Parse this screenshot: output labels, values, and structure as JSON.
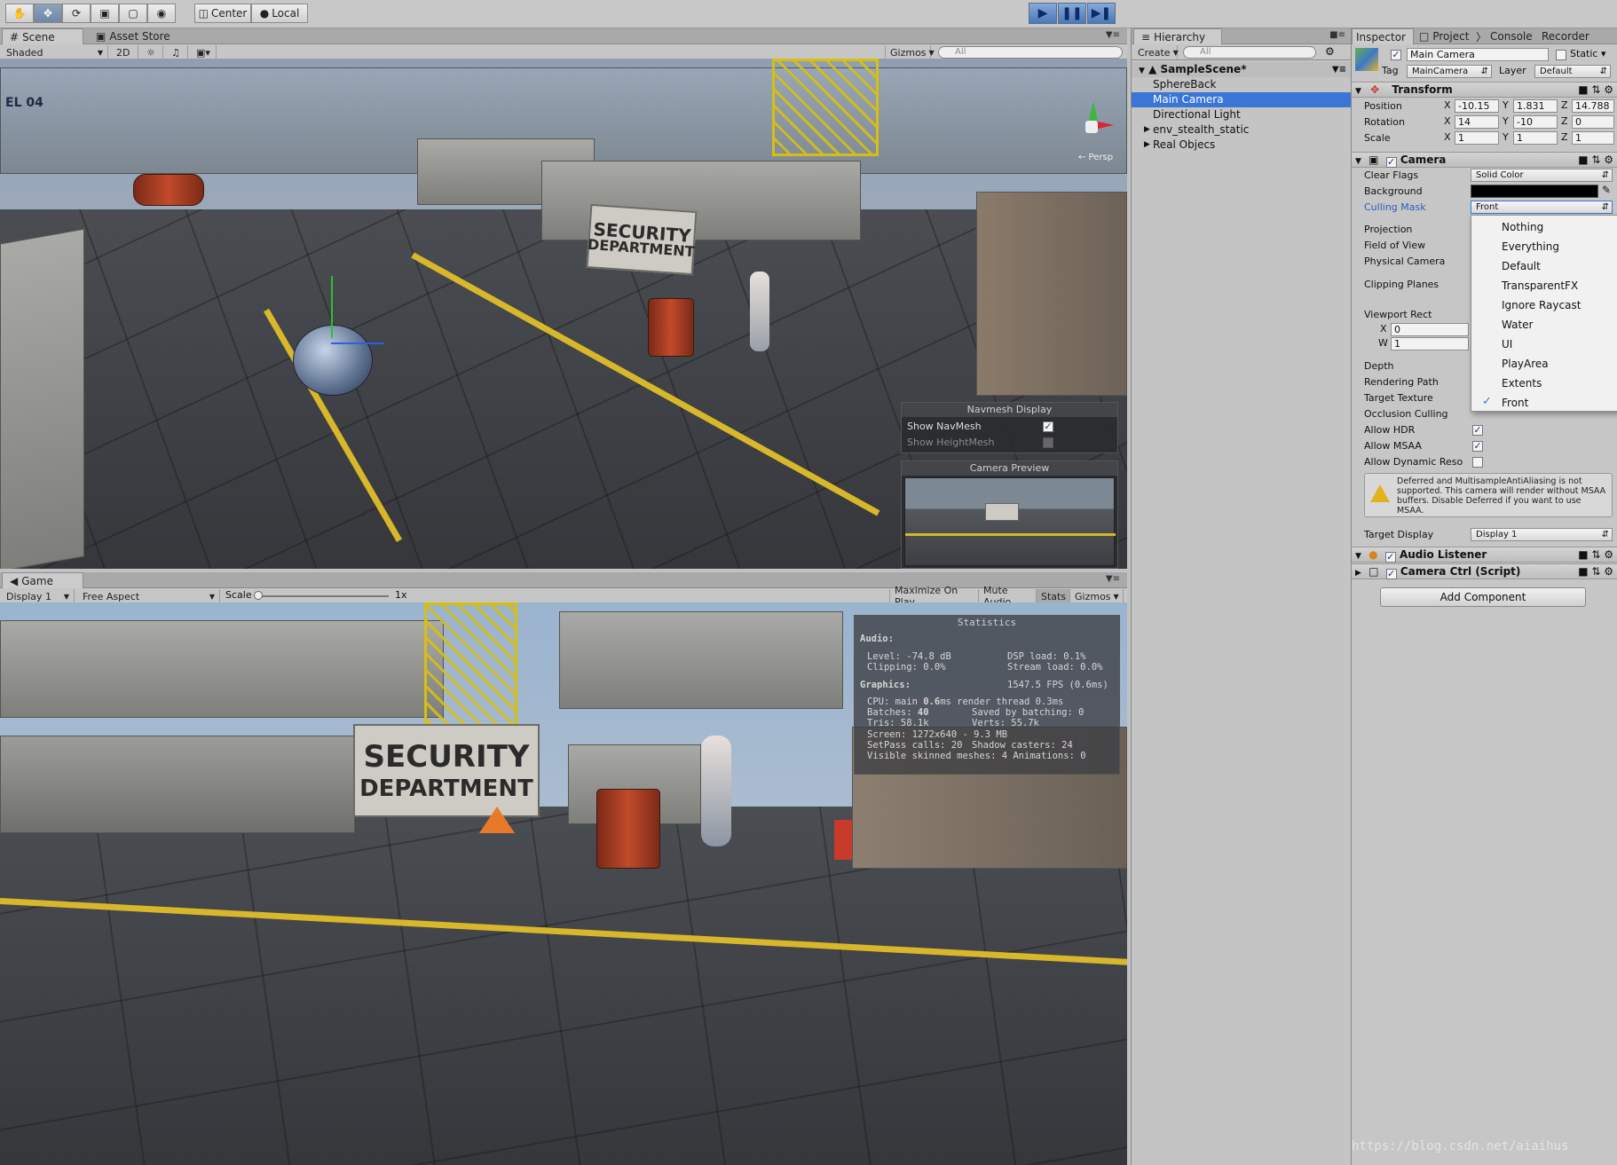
{
  "toolbar": {
    "tools": [
      "hand-icon",
      "move-icon",
      "rotate-icon",
      "scale-icon",
      "rect-icon",
      "transform-icon"
    ],
    "pivot_label": "Center",
    "space_label": "Local"
  },
  "scene": {
    "tabs": [
      "Scene",
      "Asset Store"
    ],
    "shading": "Shaded",
    "mode_2d": "2D",
    "gizmos": "Gizmos",
    "search_placeholder": "All",
    "sign_line1": "SECURITY",
    "sign_line2": "DEPARTMENT",
    "left_wall_text": "EL 04",
    "navmesh": {
      "title": "Navmesh Display",
      "show_navmesh": "Show NavMesh",
      "show_heightmesh": "Show HeightMesh"
    },
    "camera_preview_title": "Camera Preview",
    "persp_label": "← Persp"
  },
  "game": {
    "tab": "Game",
    "display": "Display 1",
    "aspect": "Free Aspect",
    "scale_label": "Scale",
    "scale_value": "1x",
    "maximize": "Maximize On Play",
    "mute": "Mute Audio",
    "stats_btn": "Stats",
    "gizmos": "Gizmos",
    "sign_line1": "SECURITY",
    "sign_line2": "DEPARTMENT",
    "statistics": {
      "title": "Statistics",
      "audio_header": "Audio:",
      "level": "Level: -74.8 dB",
      "dsp": "DSP load: 0.1%",
      "clipping": "Clipping: 0.0%",
      "stream": "Stream load: 0.0%",
      "graphics_header": "Graphics:",
      "fps": "1547.5 FPS (0.6ms)",
      "cpu_prefix": "CPU: main ",
      "cpu_main": "0.6",
      "cpu_suffix": "ms  render thread 0.3ms",
      "batches_prefix": "Batches: ",
      "batches": "40",
      "saved": "Saved by batching: 0",
      "tris": "Tris: 58.1k",
      "verts": "Verts: 55.7k",
      "screen": "Screen: 1272x640 - 9.3 MB",
      "setpass": "SetPass calls: 20",
      "shadow": "Shadow casters: 24",
      "skinned": "Visible skinned meshes: 4  Animations: 0"
    }
  },
  "hierarchy": {
    "tab": "Hierarchy",
    "create": "Create",
    "search_placeholder": "All",
    "scene_name": "SampleScene*",
    "items": [
      "SphereBack",
      "Main Camera",
      "Directional Light",
      "env_stealth_static",
      "Real Objecs"
    ],
    "selected": "Main Camera"
  },
  "inspector": {
    "tabs": [
      "Inspector",
      "Project",
      "Console",
      "Recorder"
    ],
    "object_name": "Main Camera",
    "static_label": "Static",
    "tag_label": "Tag",
    "tag_value": "MainCamera",
    "layer_label": "Layer",
    "layer_value": "Default",
    "transform": {
      "title": "Transform",
      "position_label": "Position",
      "rotation_label": "Rotation",
      "scale_label": "Scale",
      "position": [
        "-10.15",
        "1.831",
        "14.788"
      ],
      "rotation": [
        "14",
        "-10",
        "0"
      ],
      "scale": [
        "1",
        "1",
        "1"
      ],
      "axes": [
        "X",
        "Y",
        "Z"
      ]
    },
    "camera": {
      "title": "Camera",
      "clear_flags_label": "Clear Flags",
      "clear_flags_value": "Solid Color",
      "background_label": "Background",
      "culling_mask_label": "Culling Mask",
      "culling_mask_value": "Front",
      "projection_label": "Projection",
      "fov_label": "Field of View",
      "physical_label": "Physical Camera",
      "clipping_label": "Clipping Planes",
      "viewport_label": "Viewport Rect",
      "vp_x_label": "X",
      "vp_x": "0",
      "vp_w_label": "W",
      "vp_w": "1",
      "depth_label": "Depth",
      "rendering_path_label": "Rendering Path",
      "target_texture_label": "Target Texture",
      "occlusion_label": "Occlusion Culling",
      "hdr_label": "Allow HDR",
      "msaa_label": "Allow MSAA",
      "dynres_label": "Allow Dynamic Reso",
      "warning": "Deferred and MultisampleAntiAliasing is not supported. This camera will render without MSAA buffers. Disable Deferred if you want to use MSAA.",
      "target_display_label": "Target Display",
      "target_display_value": "Display 1"
    },
    "audio_listener": "Audio Listener",
    "camera_ctrl": "Camera Ctrl (Script)",
    "add_component": "Add Component"
  },
  "culling_menu": {
    "items": [
      "Nothing",
      "Everything",
      "Default",
      "TransparentFX",
      "Ignore Raycast",
      "Water",
      "UI",
      "PlayArea",
      "Extents",
      "Front"
    ],
    "checked": "Front"
  },
  "watermark": "https://blog.csdn.net/aiaihus",
  "colors": {
    "accent": "#3b76d6",
    "caution": "#d8b72a",
    "background_swatch": "#000000"
  }
}
